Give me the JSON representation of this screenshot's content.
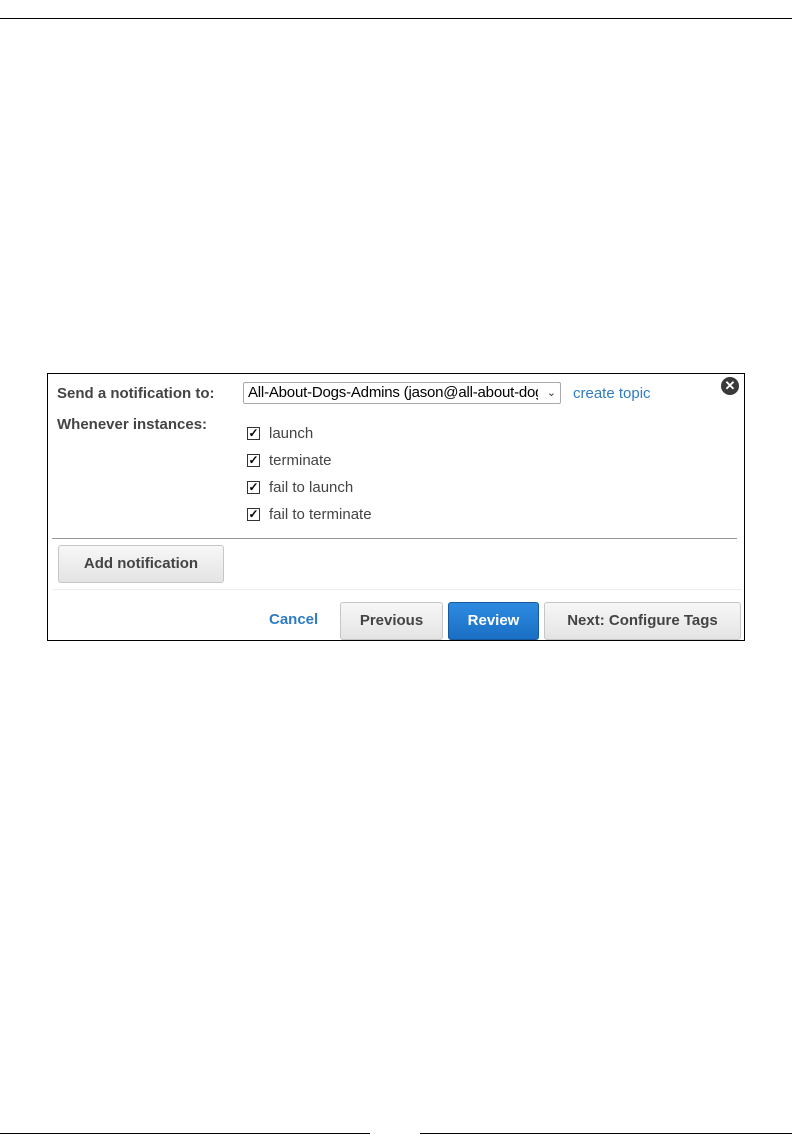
{
  "notification": {
    "send_label": "Send a notification to:",
    "topic_selected": "All-About-Dogs-Admins (jason@all-about-dogs.com)",
    "create_topic_link": "create topic",
    "instances_label": "Whenever instances:",
    "events": [
      {
        "label": "launch",
        "checked": true
      },
      {
        "label": "terminate",
        "checked": true
      },
      {
        "label": "fail to launch",
        "checked": true
      },
      {
        "label": "fail to terminate",
        "checked": true
      }
    ],
    "add_button": "Add notification"
  },
  "footer": {
    "cancel": "Cancel",
    "previous": "Previous",
    "review": "Review",
    "next": "Next: Configure Tags"
  },
  "icons": {
    "close": "close-icon",
    "chevron": "chevron-down-icon",
    "checkmark": "checkmark-icon"
  },
  "colors": {
    "link": "#2f7cc1",
    "primary_button": "#1a6fc4"
  }
}
